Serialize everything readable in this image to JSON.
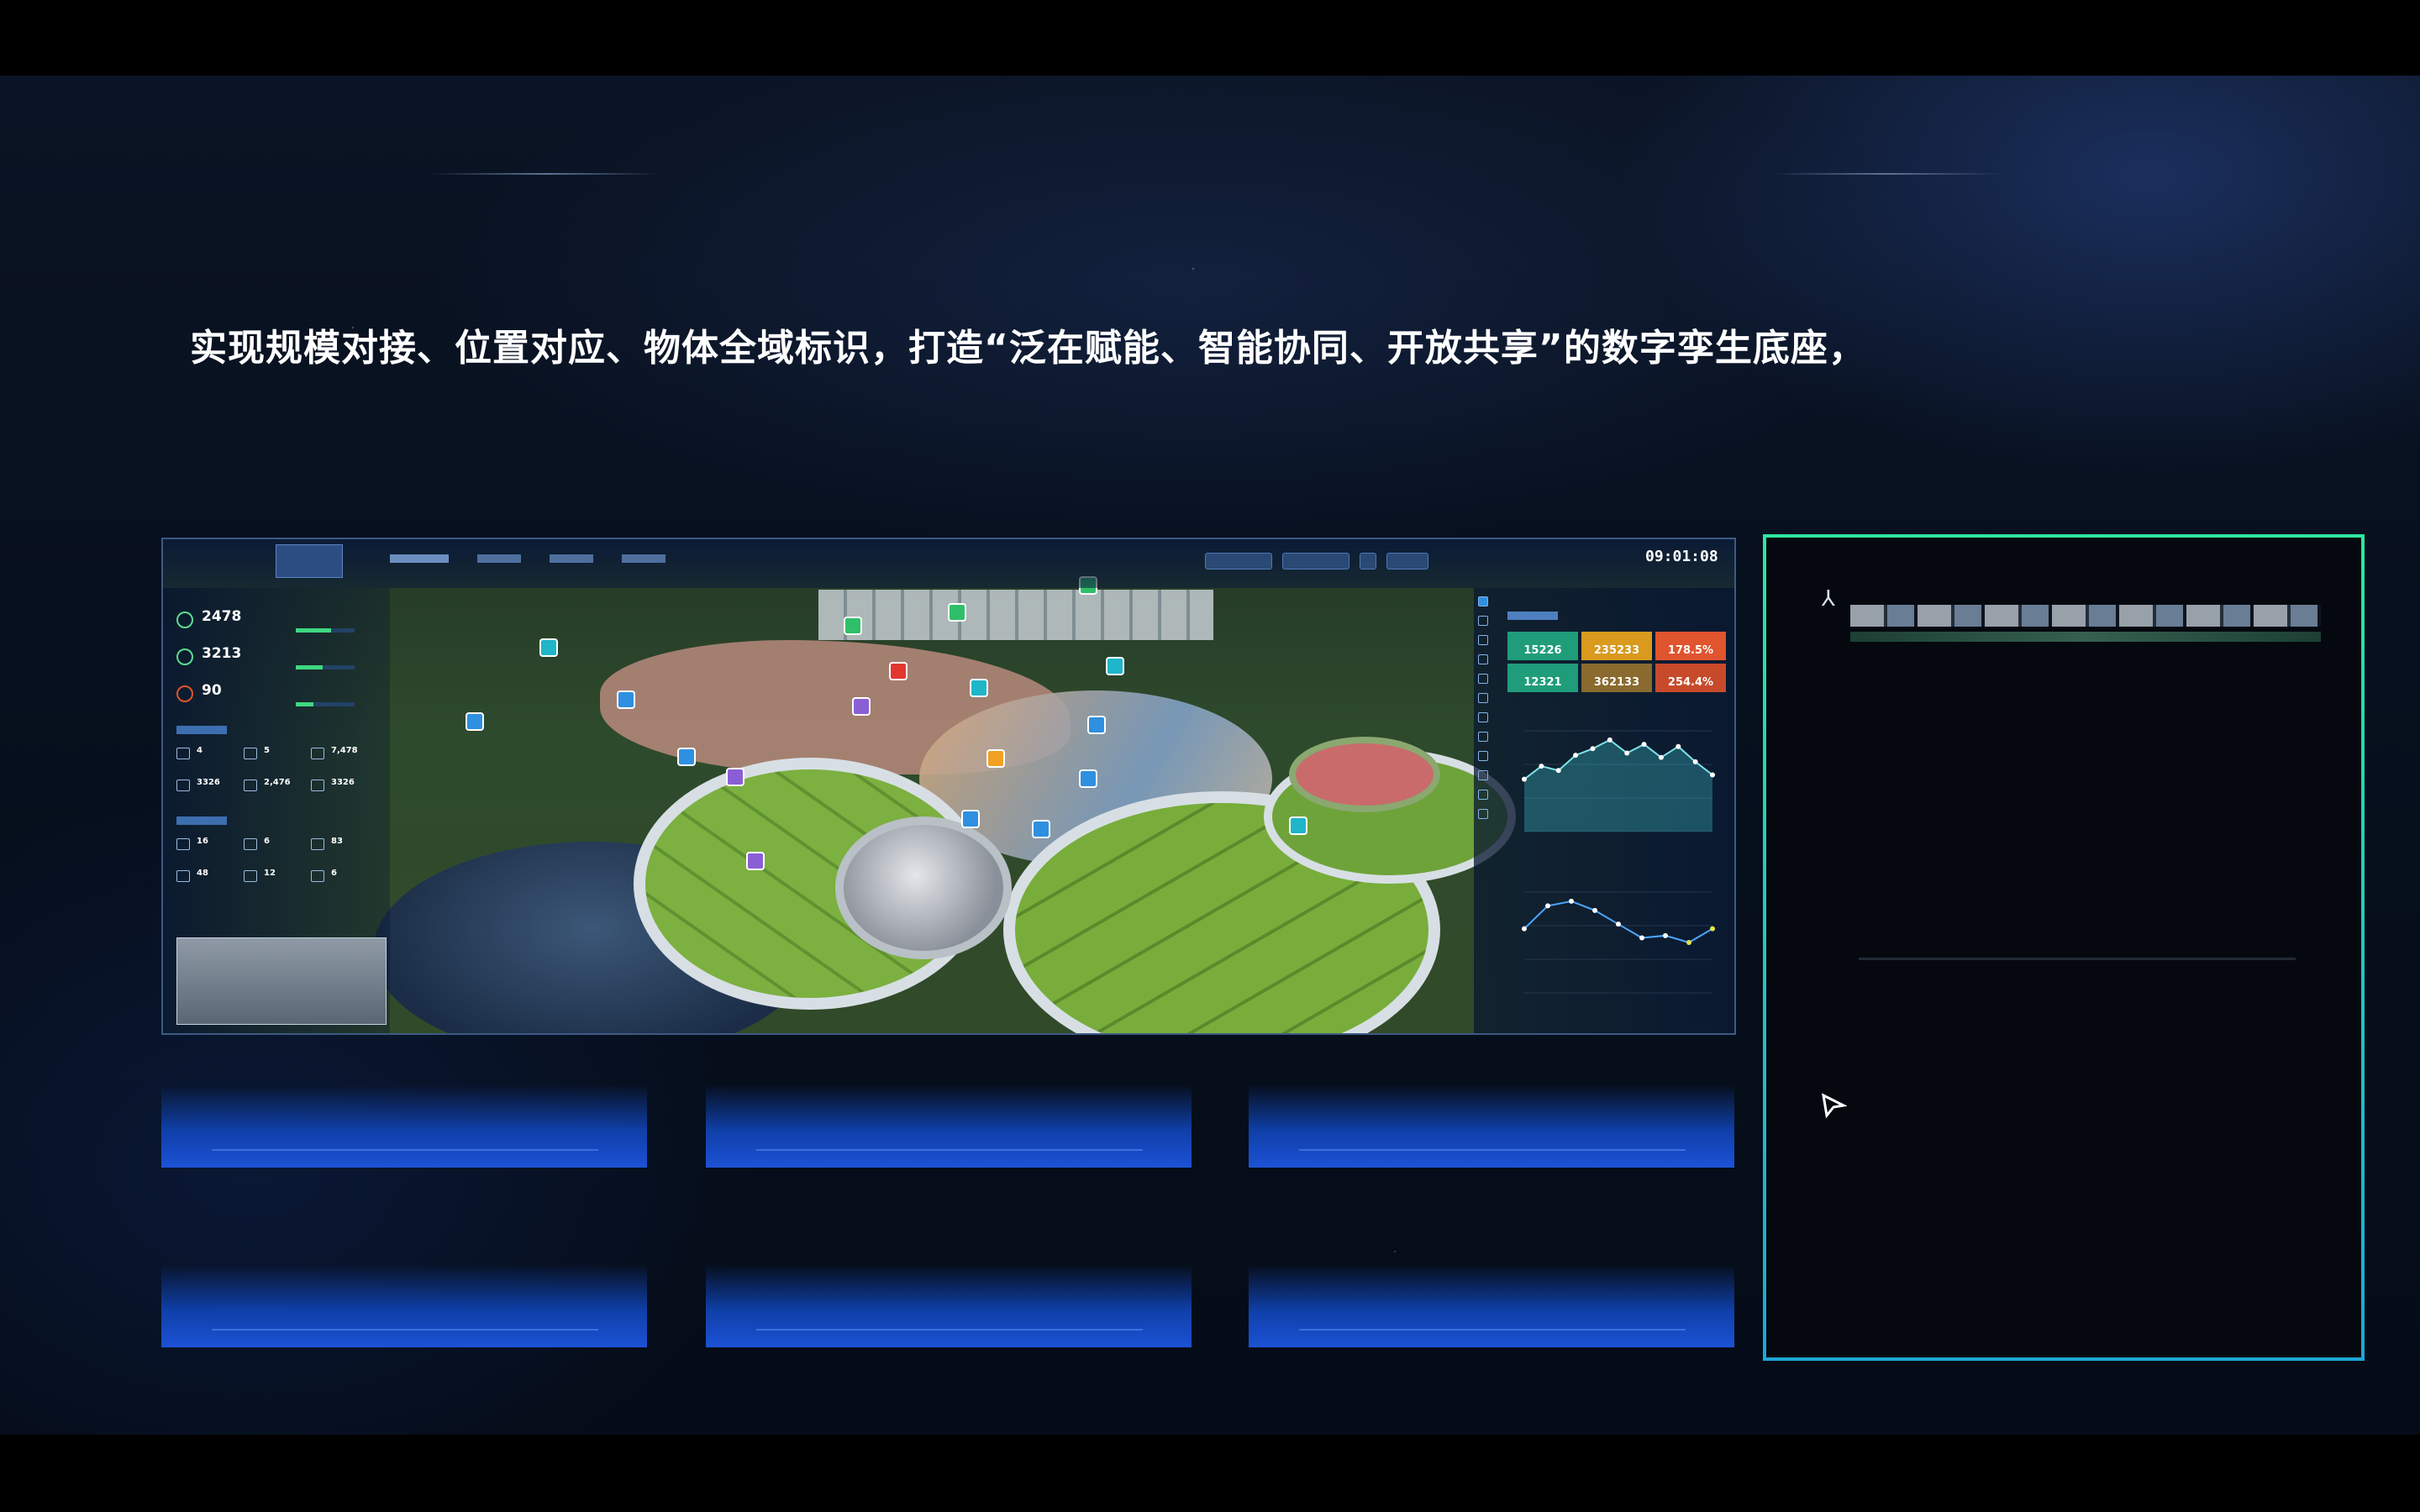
{
  "headline": "实现规模对接、位置对应、物体全域标识，打造“泛在赋能、智能协同、开放共享”的数字孪生底座，",
  "dashboard": {
    "clock": "09:01:08",
    "kpis": [
      {
        "value": "2478",
        "fill": 0.6
      },
      {
        "value": "3213",
        "fill": 0.45
      },
      {
        "value": "90",
        "fill": 0.3
      }
    ],
    "facilities": [
      {
        "value": "4"
      },
      {
        "value": "5"
      },
      {
        "value": "7,478"
      },
      {
        "value": "3326"
      },
      {
        "value": "2,476"
      },
      {
        "value": "3326"
      }
    ],
    "devices": [
      {
        "value": "16"
      },
      {
        "value": "6"
      },
      {
        "value": "83"
      },
      {
        "value": "48"
      },
      {
        "value": "12"
      },
      {
        "value": "6"
      }
    ],
    "stats": [
      {
        "value": "15226",
        "color": "#1f9d7a"
      },
      {
        "value": "235233",
        "color": "#d99a1e"
      },
      {
        "value": "178.5%",
        "color": "#e0542e"
      },
      {
        "value": "12321",
        "color": "#1f9d7a"
      },
      {
        "value": "362133",
        "color": "#8a6a2e"
      },
      {
        "value": "254.4%",
        "color": "#c74a2a"
      }
    ],
    "area_chart": {
      "type": "area",
      "values": [
        120,
        150,
        140,
        175,
        190,
        210,
        180,
        200,
        170,
        195,
        160,
        130
      ]
    },
    "line_chart": {
      "type": "line",
      "values": [
        140,
        190,
        200,
        180,
        150,
        120,
        125,
        110,
        140
      ]
    }
  },
  "colors": {
    "accent_green": "#2ee6a0",
    "accent_blue": "#1ea7d8",
    "thumb_blue": "#1c52d6"
  }
}
